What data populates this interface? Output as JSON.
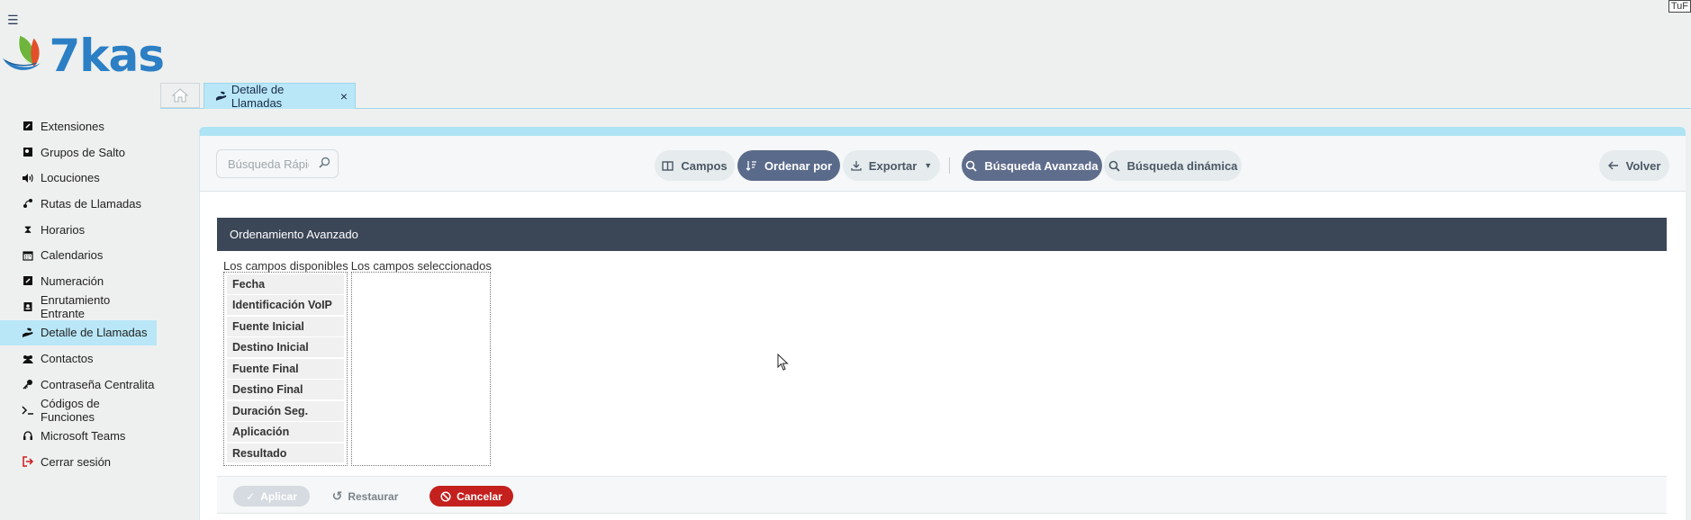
{
  "app": {
    "logo_text": "7kas",
    "corner_text": "TuF"
  },
  "tabs": {
    "active_label": "Detalle de Llamadas"
  },
  "sidebar": {
    "items": [
      {
        "label": "Extensiones",
        "icon": "extension-icon"
      },
      {
        "label": "Grupos de Salto",
        "icon": "groups-icon"
      },
      {
        "label": "Locuciones",
        "icon": "speaker-icon"
      },
      {
        "label": "Rutas de Llamadas",
        "icon": "route-icon"
      },
      {
        "label": "Horarios",
        "icon": "hourglass-icon"
      },
      {
        "label": "Calendarios",
        "icon": "calendar-icon"
      },
      {
        "label": "Numeración",
        "icon": "numbering-icon"
      },
      {
        "label": "Enrutamiento Entrante",
        "icon": "inbound-icon"
      },
      {
        "label": "Detalle de Llamadas",
        "icon": "phone-hand-icon",
        "active": true
      },
      {
        "label": "Contactos",
        "icon": "users-icon"
      },
      {
        "label": "Contraseña Centralita",
        "icon": "key-icon"
      },
      {
        "label": "Códigos de Funciones",
        "icon": "terminal-icon"
      },
      {
        "label": "Microsoft Teams",
        "icon": "headset-icon"
      },
      {
        "label": "Cerrar sesión",
        "icon": "logout-icon"
      }
    ]
  },
  "toolbar": {
    "search_placeholder": "Búsqueda Rápida",
    "campos": "Campos",
    "ordenar": "Ordenar por",
    "exportar": "Exportar",
    "busqueda_avanzada": "Búsqueda Avanzada",
    "busqueda_dinamica": "Búsqueda dinámica",
    "volver": "Volver"
  },
  "panel": {
    "title": "Ordenamiento Avanzado",
    "available_label": "Los campos disponibles",
    "selected_label": "Los campos seleccionados",
    "available_fields": [
      "Fecha",
      "Identificación VoIP",
      "Fuente Inicial",
      "Destino Inicial",
      "Fuente Final",
      "Destino Final",
      "Duración Seg.",
      "Aplicación",
      "Resultado"
    ],
    "selected_fields": []
  },
  "footer": {
    "apply": "Aplicar",
    "restore": "Restaurar",
    "cancel": "Cancelar"
  },
  "colors": {
    "accent_light": "#b9e7f7",
    "header_dark": "#3b4656",
    "button_dark": "#5a6a8a",
    "danger": "#c4201d",
    "brand_blue": "#2c7fc5"
  }
}
